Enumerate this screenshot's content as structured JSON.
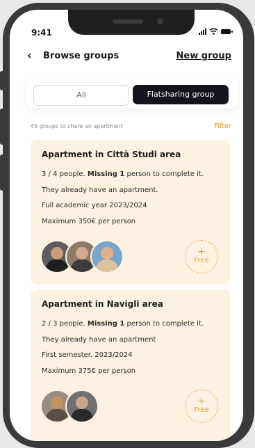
{
  "status": {
    "time": "9:41"
  },
  "header": {
    "back_icon": "‹",
    "title": "Browse groups",
    "new_group": "New group"
  },
  "tabs": [
    {
      "label": "All",
      "active": false
    },
    {
      "label": "Flatsharing group",
      "active": true
    }
  ],
  "list": {
    "count_text": "45 groups to share an apartment",
    "filter_label": "Filter"
  },
  "cards": [
    {
      "title": "Apartment in Città Studi area",
      "people": "3 / 4 people.",
      "missing": "Missing 1",
      "missing_rest": "person to complete it.",
      "line2": "They already have an apartment.",
      "line3": "Full academic year 2023/2024",
      "line4": "Maximum 350€ per person",
      "free_plus": "+",
      "free_label": "Free"
    },
    {
      "title": "Apartment in Navigli area",
      "people": "2 / 3 people.",
      "missing": "Missing 1",
      "missing_rest": "person to complete it.",
      "line2": "They already have an apartment",
      "line3": "First semester. 2023/2024",
      "line4": "Maximum 375€ per person",
      "free_plus": "+",
      "free_label": "Free"
    }
  ],
  "colors": {
    "accent": "#e09a2c",
    "card_bg": "#fdf1e2",
    "dark_button": "#15141c"
  }
}
